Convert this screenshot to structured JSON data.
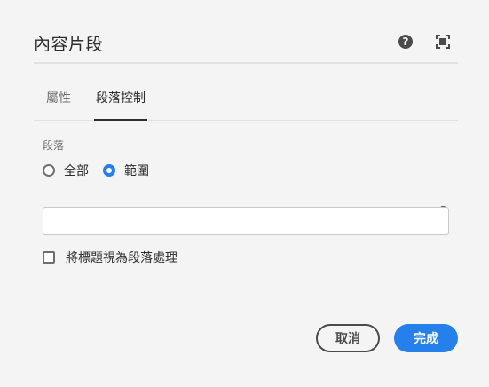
{
  "header": {
    "title": "內容片段",
    "help_icon": "help-circle-icon",
    "fullscreen_icon": "fullscreen-icon"
  },
  "tabs": [
    {
      "label": "屬性",
      "active": false
    },
    {
      "label": "段落控制",
      "active": true
    }
  ],
  "paragraph": {
    "section_label": "段落",
    "radio_options": [
      {
        "label": "全部",
        "checked": false
      },
      {
        "label": "範圍",
        "checked": true
      }
    ],
    "range_input": {
      "value": "",
      "placeholder": ""
    },
    "info_icon": "info-icon",
    "heading_checkbox": {
      "label": "將標題視為段落處理",
      "checked": false
    }
  },
  "footer": {
    "cancel_label": "取消",
    "done_label": "完成"
  },
  "colors": {
    "accent": "#2680eb",
    "background": "#f4f4f4",
    "text": "#2c2c2c"
  }
}
